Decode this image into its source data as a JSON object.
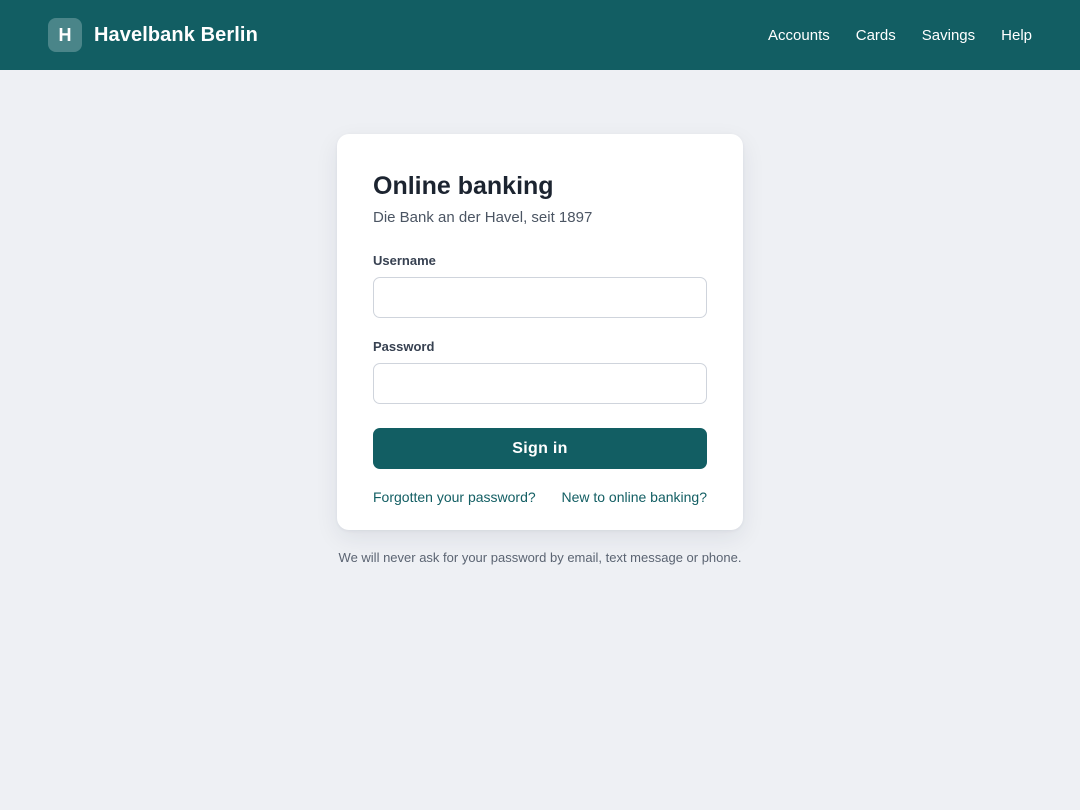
{
  "header": {
    "logo_letter": "H",
    "brand_name": "Havelbank Berlin",
    "nav": [
      {
        "label": "Accounts"
      },
      {
        "label": "Cards"
      },
      {
        "label": "Savings"
      },
      {
        "label": "Help"
      }
    ]
  },
  "login": {
    "title": "Online banking",
    "subtitle": "Die Bank an der Havel, seit 1897",
    "username_label": "Username",
    "username_value": "",
    "password_label": "Password",
    "password_value": "",
    "signin_label": "Sign in",
    "forgot_link": "Forgotten your password?",
    "register_link": "New to online banking?"
  },
  "footer": {
    "notice": "We will never ask for your password by email, text message or phone."
  },
  "colors": {
    "brand": "#125e63",
    "page_background": "#eef0f4",
    "card_background": "#ffffff"
  }
}
